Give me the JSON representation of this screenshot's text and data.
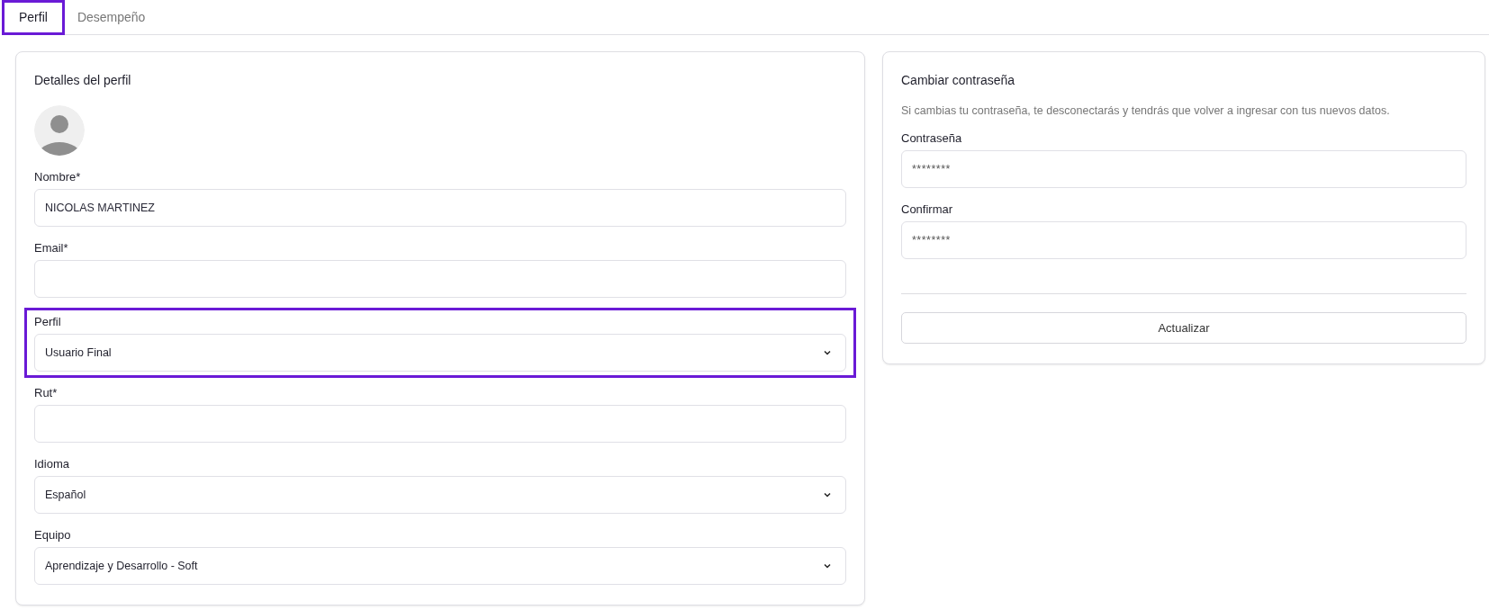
{
  "tabs": [
    {
      "label": "Perfil",
      "selected": true,
      "highlighted": true
    },
    {
      "label": "Desempeño",
      "selected": false,
      "highlighted": false
    }
  ],
  "profile_card": {
    "title": "Detalles del perfil",
    "fields": [
      {
        "label": "Nombre*",
        "kind": "text",
        "value": "NICOLAS MARTINEZ",
        "highlighted": false
      },
      {
        "label": "Email*",
        "kind": "text",
        "highlighted": false
      },
      {
        "label": "Perfil",
        "kind": "select",
        "value": "Usuario Final",
        "highlighted": true
      },
      {
        "label": "Rut*",
        "kind": "text",
        "highlighted": false
      },
      {
        "label": "Idioma",
        "kind": "select",
        "value": "Español",
        "highlighted": false
      },
      {
        "label": "Equipo",
        "kind": "select",
        "value": "Aprendizaje y Desarrollo - Soft",
        "highlighted": false
      }
    ]
  },
  "password_card": {
    "title": "Cambiar contraseña",
    "description": "Si cambias tu contraseña, te desconectarás y tendrás que volver a ingresar con tus nuevos datos.",
    "fields": [
      {
        "label": "Contraseña",
        "kind": "password",
        "value": "********",
        "highlighted": false
      },
      {
        "label": "Confirmar",
        "kind": "password",
        "value": "********",
        "highlighted": false
      }
    ],
    "button": "Actualizar"
  }
}
